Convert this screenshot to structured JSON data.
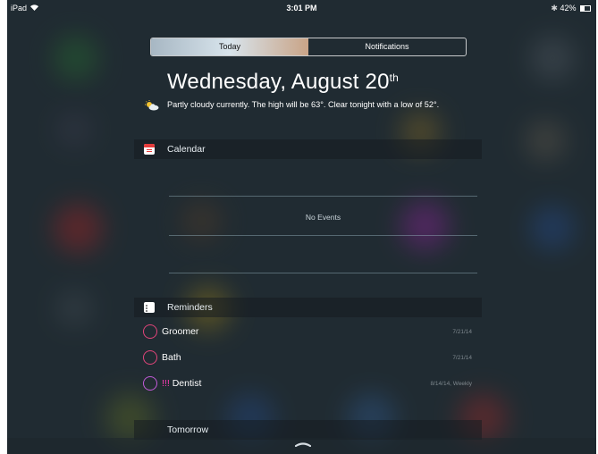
{
  "status": {
    "device": "iPad",
    "time": "3:01 PM",
    "battery": "42%",
    "battery_level": 0.42
  },
  "tabs": [
    {
      "label": "Today",
      "active": true
    },
    {
      "label": "Notifications",
      "active": false
    }
  ],
  "today": {
    "date": "Wednesday, August 20",
    "date_suffix": "th",
    "weather_icon": "partly-cloudy-icon",
    "weather": "Partly cloudy currently. The high will be 63°. Clear tonight with a low of 52°."
  },
  "calendar": {
    "title": "Calendar",
    "icon": "calendar-icon",
    "empty_text": "No Events"
  },
  "reminders": {
    "title": "Reminders",
    "icon": "reminders-icon",
    "items": [
      {
        "priority": "",
        "name": "Groomer",
        "date": "7/21/14",
        "color": "#e0457a"
      },
      {
        "priority": "",
        "name": "Bath",
        "date": "7/21/14",
        "color": "#e0457a"
      },
      {
        "priority": "!!!",
        "name": "Dentist",
        "date": "8/14/14, Weekly",
        "color": "#c15ad8"
      }
    ]
  },
  "tomorrow": {
    "title": "Tomorrow"
  },
  "colors": {
    "background": "#27343c",
    "reminder_circle": "#e0457a",
    "priority": "#ff3db6"
  }
}
